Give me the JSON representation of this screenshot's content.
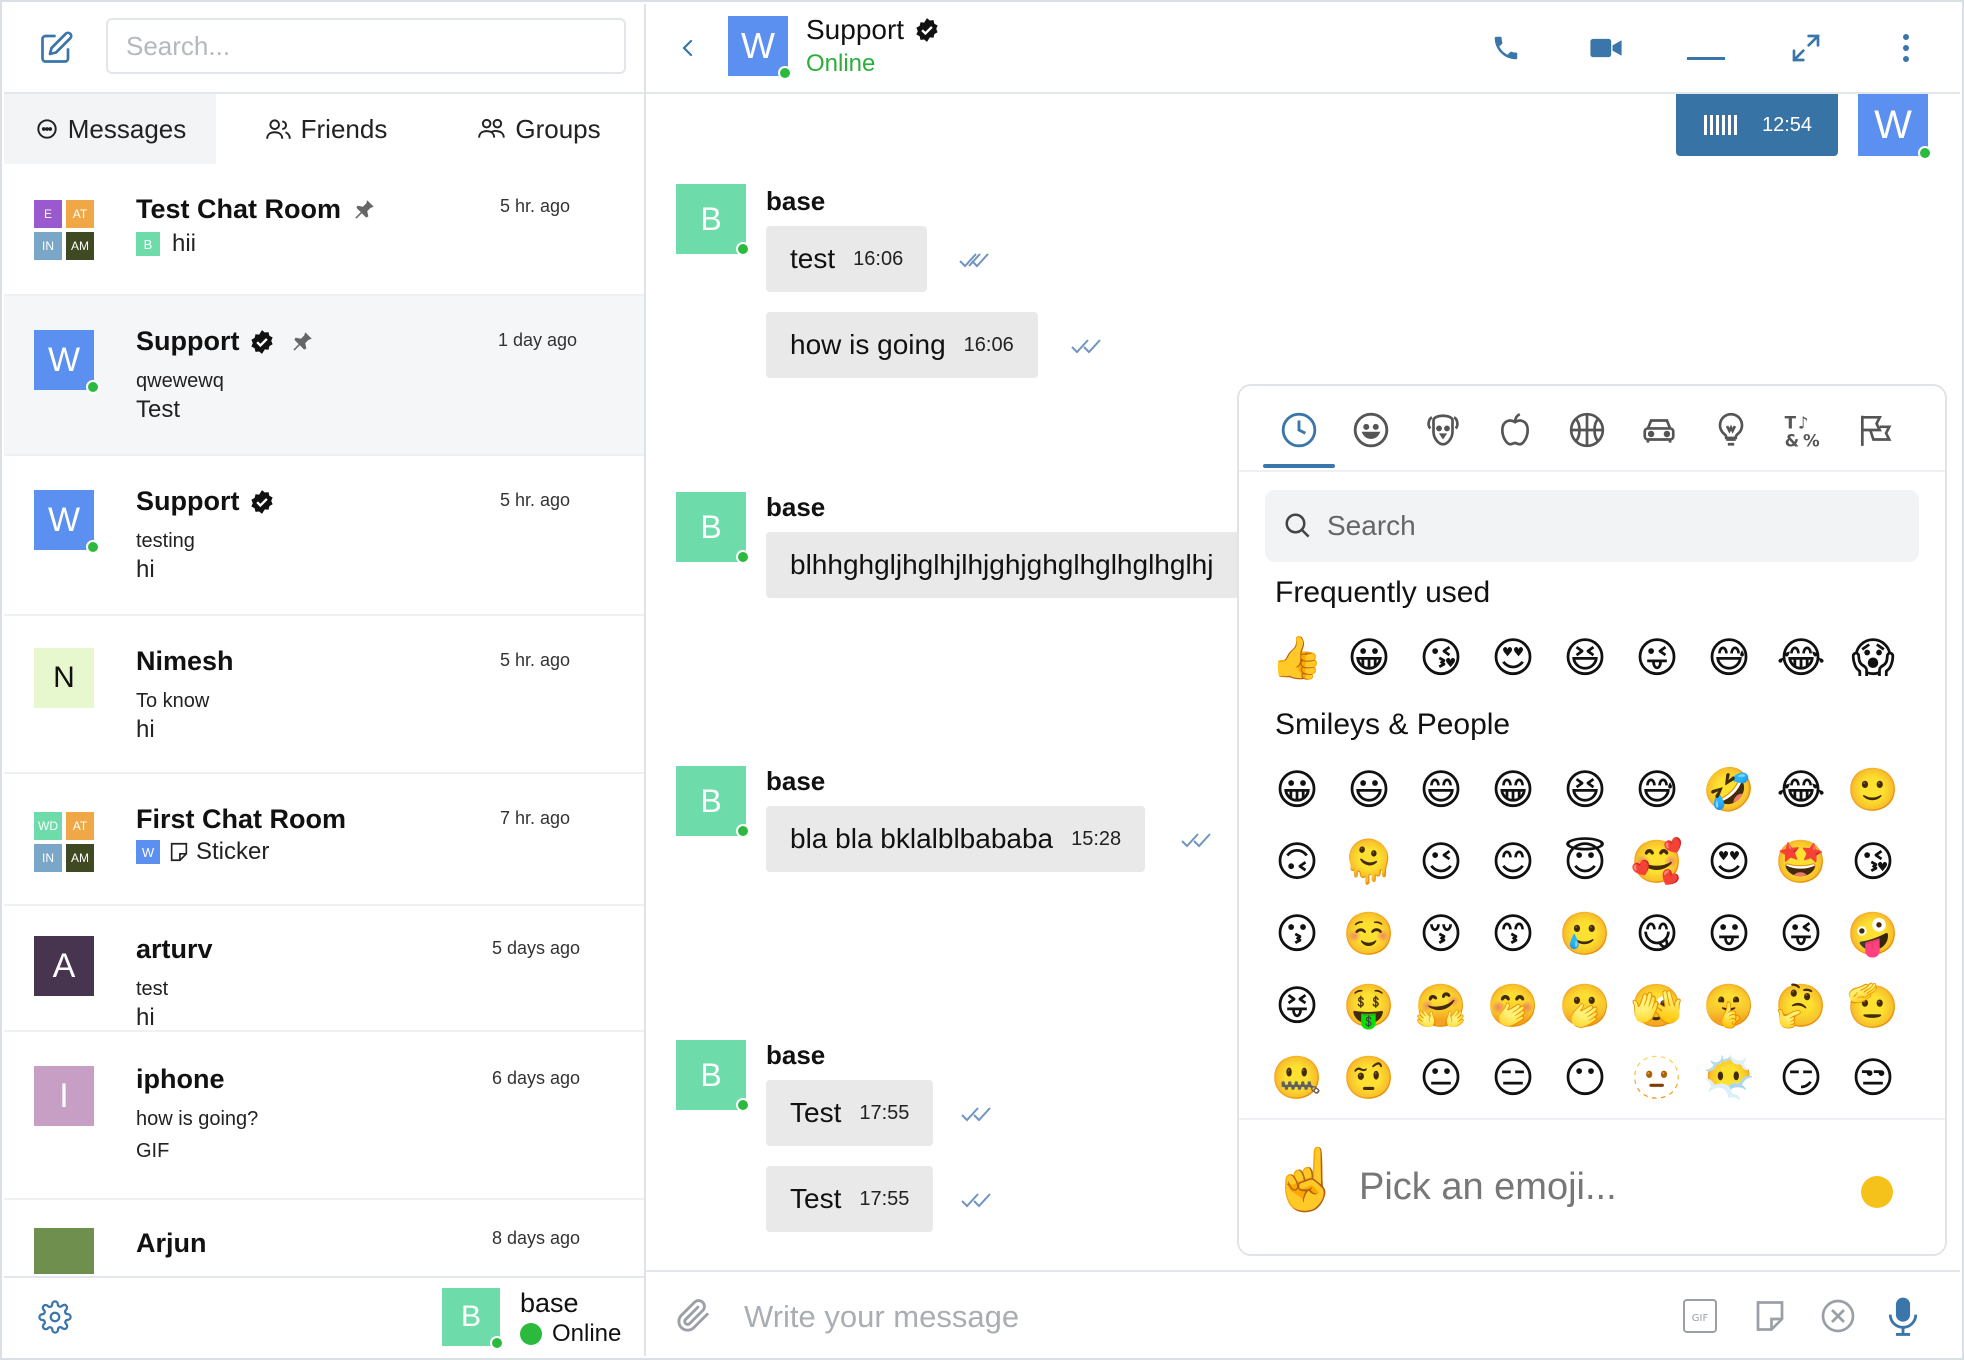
{
  "colors": {
    "accent": "#3b76aa",
    "online": "#2cba3e",
    "bubble": "#e9e9ea",
    "my_bubble": "#3873a6"
  },
  "left": {
    "search_placeholder": "Search...",
    "tabs": [
      {
        "label": "Messages",
        "icon": "chat-bubbles-icon"
      },
      {
        "label": "Friends",
        "icon": "friends-icon"
      },
      {
        "label": "Groups",
        "icon": "groups-icon"
      }
    ],
    "chats": [
      {
        "name": "Test Chat Room",
        "time": "5 hr. ago",
        "grid": [
          "E",
          "AT",
          "IN",
          "AM"
        ],
        "last_avatar": "B",
        "last": "hii",
        "pinned": true
      },
      {
        "name": "Support",
        "time": "1 day ago",
        "avatar": "W",
        "sub": "qwewewq",
        "last": "Test",
        "verified": true,
        "pinned": true
      },
      {
        "name": "Support",
        "time": "5 hr. ago",
        "avatar": "W",
        "sub": "testing",
        "last": "hi",
        "verified": true
      },
      {
        "name": "Nimesh",
        "time": "5 hr. ago",
        "avatar": "N",
        "sub": "To know",
        "last": "hi"
      },
      {
        "name": "First Chat Room",
        "time": "7 hr. ago",
        "grid": [
          "WD",
          "AT",
          "IN",
          "AM"
        ],
        "last_avatar": "W",
        "last": "Sticker"
      },
      {
        "name": "arturv",
        "time": "5 days ago",
        "avatar": "A",
        "sub": "test",
        "last": "hi"
      },
      {
        "name": "iphone",
        "time": "6 days ago",
        "avatar": "I",
        "sub": "how is going?",
        "last": "GIF"
      },
      {
        "name": "Arjun",
        "time": "8 days ago"
      }
    ],
    "footer": {
      "avatar": "B",
      "name": "base",
      "status": "Online"
    }
  },
  "header": {
    "avatar": "W",
    "name": "Support",
    "status": "Online"
  },
  "my_message": {
    "time": "12:54"
  },
  "messages": [
    {
      "author": "base",
      "avatar": "B",
      "bubbles": [
        {
          "text": "test",
          "time": "16:06"
        },
        {
          "text": "how is going",
          "time": "16:06"
        }
      ]
    },
    {
      "author": "base",
      "avatar": "B",
      "bubbles": [
        {
          "text": "blhhghgljhglhjlhjghjghglhglhglhglhj",
          "time": ""
        }
      ]
    },
    {
      "author": "base",
      "avatar": "B",
      "bubbles": [
        {
          "text": "bla bla bklalblbababa",
          "time": "15:28"
        }
      ]
    },
    {
      "author": "base",
      "avatar": "B",
      "bubbles": [
        {
          "text": "Test",
          "time": "17:55"
        },
        {
          "text": "Test",
          "time": "17:55"
        }
      ]
    }
  ],
  "composer": {
    "placeholder": "Write your message"
  },
  "picker": {
    "search_placeholder": "Search",
    "sections": {
      "frequent": "Frequently used",
      "smileys": "Smileys & People"
    },
    "frequent": [
      "👍",
      "😀",
      "😘",
      "😍",
      "😆",
      "😜",
      "😅",
      "😂",
      "😱"
    ],
    "smileys": [
      [
        "😀",
        "😃",
        "😄",
        "😁",
        "😆",
        "😅",
        "🤣",
        "😂",
        "🙂"
      ],
      [
        "🙃",
        "🫠",
        "😉",
        "😊",
        "😇",
        "🥰",
        "😍",
        "🤩",
        "😘"
      ],
      [
        "😗",
        "☺️",
        "😚",
        "😙",
        "🥲",
        "😋",
        "😛",
        "😜",
        "🤪"
      ],
      [
        "😝",
        "🤑",
        "🤗",
        "🤭",
        "🫢",
        "🫣",
        "🤫",
        "🤔",
        "🫡"
      ],
      [
        "🤐",
        "🤨",
        "😐",
        "😑",
        "😶",
        "🫥",
        "😶‍🌫️",
        "😏",
        "😒"
      ]
    ],
    "preview_emoji": "☝️",
    "preview_text": "Pick an emoji..."
  }
}
